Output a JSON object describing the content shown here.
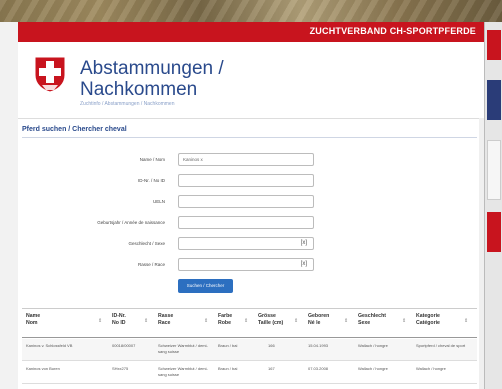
{
  "header": {
    "org_name": "ZUCHTVERBAND CH-SPORTPFERDE"
  },
  "page": {
    "title_line1": "Abstammungen /",
    "title_line2": "Nachkommen",
    "breadcrumb": "Zuchtinfo / Abstammungen / Nachkommen"
  },
  "search": {
    "section_title": "Pferd suchen / Chercher cheval",
    "fields": [
      {
        "label": "Name / Nom",
        "value": "Kaninos x",
        "kind": "input"
      },
      {
        "label": "ID-Nr. / No ID",
        "value": "",
        "kind": "input"
      },
      {
        "label": "UELN",
        "value": "",
        "kind": "input"
      },
      {
        "label": "Geburtsjahr / Année de naissance",
        "value": "",
        "kind": "input"
      },
      {
        "label": "Geschlecht / Sexe",
        "value": "",
        "kind": "select",
        "clear": "[x]"
      },
      {
        "label": "Rasse / Race",
        "value": "",
        "kind": "select",
        "clear": "[x]"
      }
    ],
    "button_label": "Suchen / Chercher"
  },
  "results": {
    "columns": [
      {
        "line1": "Name",
        "line2": "Nom"
      },
      {
        "line1": "ID-Nr.",
        "line2": "No ID"
      },
      {
        "line1": "Rasse",
        "line2": "Race"
      },
      {
        "line1": "Farbe",
        "line2": "Robe"
      },
      {
        "line1": "Grösse",
        "line2": "Taille (cm)"
      },
      {
        "line1": "Geboren",
        "line2": "Né le"
      },
      {
        "line1": "Geschlecht",
        "line2": "Sexe"
      },
      {
        "line1": "Kategorie",
        "line2": "Catégorie"
      }
    ],
    "sort_icon": "sort-arrows-icon",
    "rows": [
      [
        "Kaninos v. Schlossfeld VB",
        "00018/00007",
        "Schweizer Warmblut / demi-sang suisse",
        "Braun / bai",
        "166",
        "15.04.1993",
        "Wallach / hongre",
        "Sportpferd / cheval de sport"
      ],
      [
        "Kaninos von Buren",
        "SHxx275",
        "Schweizer Warmblut / demi-sang suisse",
        "Braun / bai",
        "167",
        "07.03.2008",
        "Wallach / hongre",
        "Wallach / hongre"
      ]
    ]
  },
  "colors": {
    "brand_red": "#c8141e",
    "title_blue": "#2a4a8c",
    "button_blue": "#2c6fc0"
  }
}
